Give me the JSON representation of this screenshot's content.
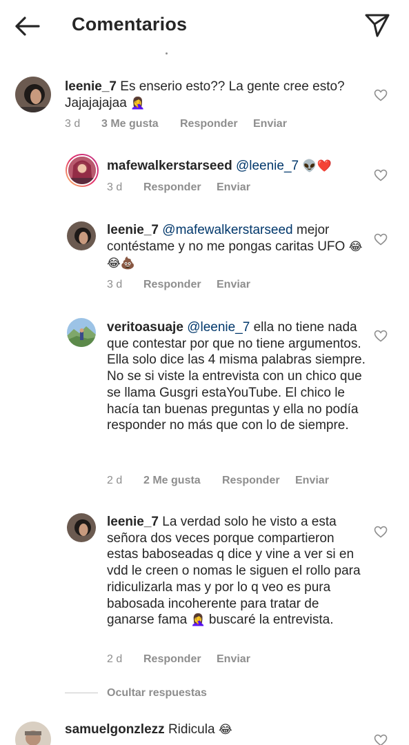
{
  "header": {
    "title": "Comentarios",
    "back_icon": "arrow-left-icon",
    "send_icon": "paper-plane-icon"
  },
  "comments": [
    {
      "username": "leenie_7",
      "mention": "",
      "text": "Es enserio esto?? La gente cree esto? Jajajajajaa",
      "emoji": "🤦‍♀️",
      "time": "3 d",
      "likes": "3 Me gusta",
      "reply_label": "Responder",
      "send_label": "Enviar"
    },
    {
      "username": "mafewalkerstarseed",
      "mention": "@leenie_7",
      "text": "",
      "emoji": "👽❤️",
      "time": "3 d",
      "likes": "",
      "reply_label": "Responder",
      "send_label": "Enviar"
    },
    {
      "username": "leenie_7",
      "mention": "@mafewalkerstarseed",
      "text": "mejor contéstame y no me pongas caritas UFO",
      "emoji": "😂😂💩",
      "time": "3 d",
      "likes": "",
      "reply_label": "Responder",
      "send_label": "Enviar"
    },
    {
      "username": "veritoasuaje",
      "mention": "@leenie_7",
      "text": "ella no tiene nada que contestar por que no tiene argumentos. Ella solo dice las 4 misma palabras siempre. No se si viste la entrevista con un chico que se llama Gusgri estaYouTube. El chico le hacía tan buenas preguntas y ella no podía responder no más que con lo de siempre.",
      "emoji": "",
      "time": "2 d",
      "likes": "2 Me gusta",
      "reply_label": "Responder",
      "send_label": "Enviar"
    },
    {
      "username": "leenie_7",
      "mention": "",
      "text_before": "La verdad solo he visto a esta señora dos veces porque compartieron estas baboseadas q dice y vine a ver si en vdd le creen o nomas le siguen el rollo para ridiculizarla mas y por lo q veo es pura babosada incoherente para tratar de ganarse fama",
      "emoji": "🤦‍♀️",
      "text_after": "buscaré la entrevista.",
      "time": "2 d",
      "likes": "",
      "reply_label": "Responder",
      "send_label": "Enviar"
    },
    {
      "username": "samuelgonzlezz",
      "mention": "",
      "text": "Ridicula",
      "emoji": "😂"
    }
  ],
  "hide_replies_label": "Ocultar respuestas",
  "colors": {
    "text": "#262626",
    "secondary": "#8e8e8e",
    "mention": "#00376b",
    "background": "#ffffff"
  }
}
